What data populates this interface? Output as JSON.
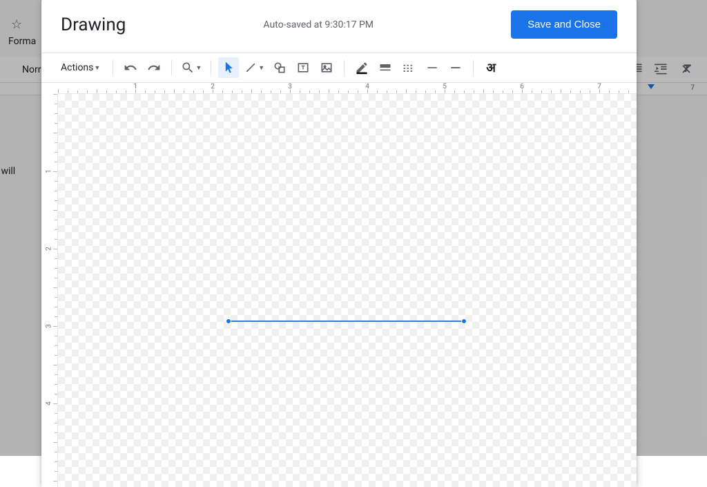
{
  "background": {
    "format_menu": "Forma",
    "normal_text": "Norr",
    "content_text": "it will",
    "ruler_num": "7"
  },
  "dialog": {
    "title": "Drawing",
    "autosave": "Auto-saved at 9:30:17 PM",
    "save_close": "Save and Close",
    "toolbar": {
      "actions": "Actions",
      "indic": "अ"
    },
    "ruler_h": [
      "1",
      "2",
      "3",
      "4",
      "5",
      "6",
      "7"
    ],
    "ruler_v": [
      "1",
      "2",
      "3",
      "4"
    ]
  }
}
